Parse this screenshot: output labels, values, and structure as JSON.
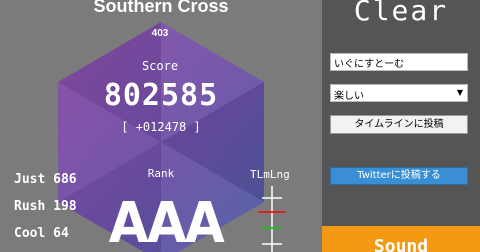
{
  "result": {
    "song_title": "Southern Cross",
    "level": "403",
    "score_label": "Score",
    "score": "802585",
    "score_diff": "[ +012478 ]",
    "rank_label": "Rank",
    "rank": "AAA",
    "judgements": [
      {
        "label": "Just",
        "value": "686"
      },
      {
        "label": "Rush",
        "value": "198"
      },
      {
        "label": "Cool",
        "value": "64"
      }
    ],
    "timing_label": "TLmLng"
  },
  "panel": {
    "title": "Clear",
    "comment_value": "いぐにすとーむ",
    "feeling_selected": "楽しい",
    "timeline_button": "タイムラインに投稿",
    "twitter_button": "Twitterに投稿する",
    "bottom_bar_text": "Sound"
  },
  "colors": {
    "hexagon_top": "#8a4ca5",
    "hexagon_bottom": "#4a5ca0",
    "panel_bg": "#555555",
    "twitter_blue": "#3a8fd4",
    "bottom_bar": "#f39a12",
    "timing_early": "#e02020",
    "timing_late": "#28b428"
  }
}
